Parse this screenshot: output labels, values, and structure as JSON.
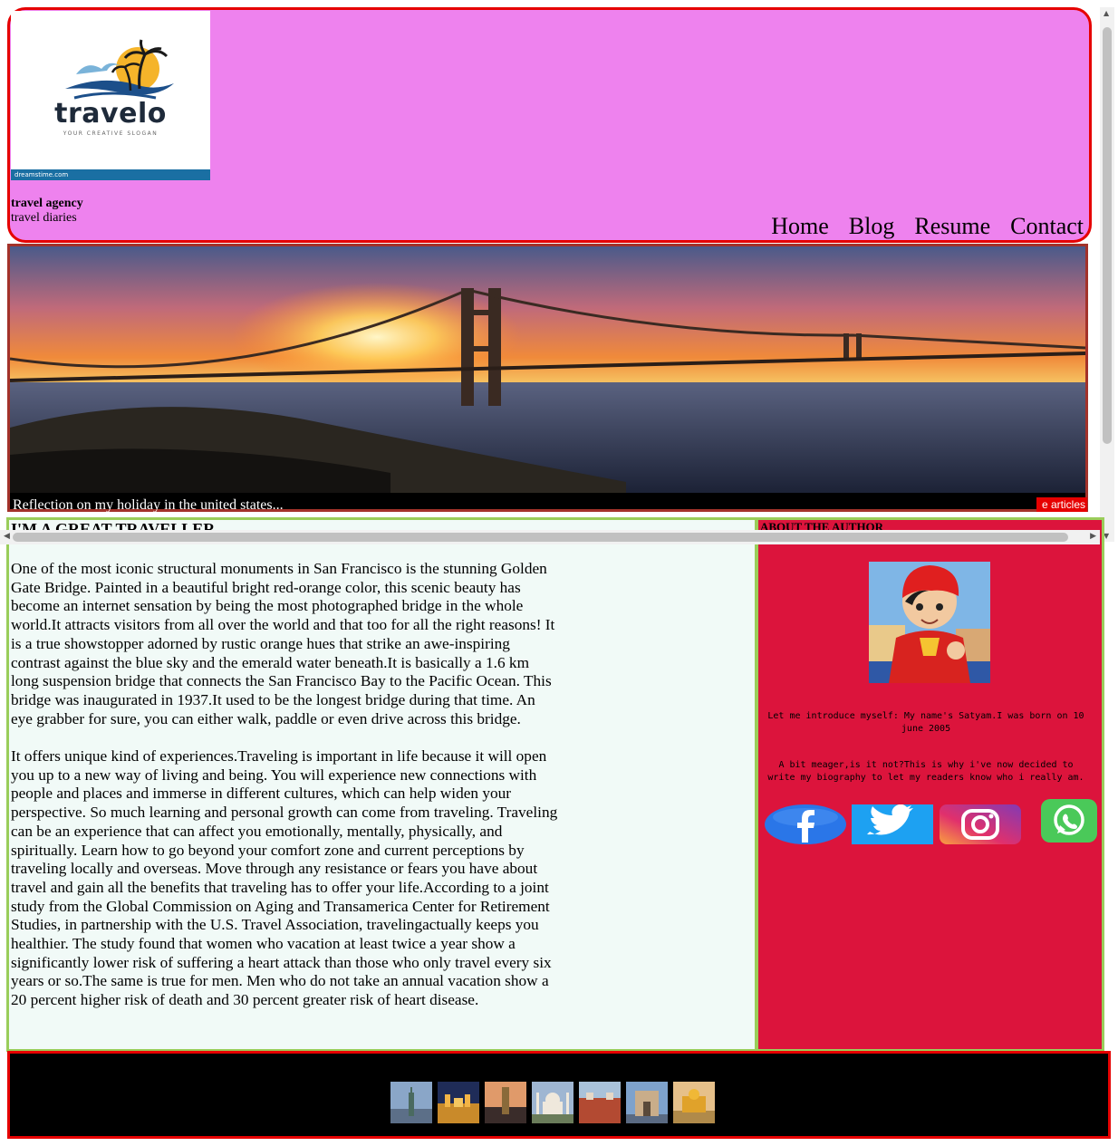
{
  "header": {
    "logo_text": "travelo",
    "logo_slogan": "YOUR CREATIVE SLOGAN",
    "logo_watermark": "dreamstime.com",
    "site_title": "travel agency",
    "site_subtitle": "travel diaries",
    "nav": [
      {
        "label": "Home"
      },
      {
        "label": "Blog"
      },
      {
        "label": "Resume"
      },
      {
        "label": "Contact"
      }
    ]
  },
  "hero": {
    "caption": "Reflection on my holiday in the united states...",
    "ticker": "e articles"
  },
  "article": {
    "heading": "I'M A GREAT TRAVELLER",
    "paragraphs": [
      "One of the most iconic structural monuments in San Francisco is the stunning Golden Gate Bridge. Painted in a beautiful bright red-orange color, this scenic beauty has become an internet sensation by being the most photographed bridge in the whole world.It attracts visitors from all over the world and that too for all the right reasons! It is a true showstopper adorned by rustic orange hues that strike an awe-inspiring contrast against the blue sky and the emerald water beneath.It is basically a 1.6 km long suspension bridge that connects the San Francisco Bay to the Pacific Ocean. This bridge was inaugurated in 1937.It used to be the longest bridge during that time. An eye grabber for sure, you can either walk, paddle or even drive across this bridge.",
      "It offers unique kind of experiences.Traveling is important in life because it will open you up to a new way of living and being. You will experience new connections with people and places and immerse in different cultures, which can help widen your perspective. So much learning and personal growth can come from traveling. Traveling can be an experience that can affect you emotionally, mentally, physically, and spiritually. Learn how to go beyond your comfort zone and current perceptions by traveling locally and overseas. Move through any resistance or fears you have about travel and gain all the benefits that traveling has to offer your life.According to a joint study from the Global Commission on Aging and Transamerica Center for Retirement Studies, in partnership with the U.S. Travel Association, travelingactually keeps you healthier. The study found that women who vacation at least twice a year show a significantly lower risk of suffering a heart attack than those who only travel every six years or so.The same is true for men. Men who do not take an annual vacation show a 20 percent higher risk of death and 30 percent greater risk of heart disease."
    ]
  },
  "sidebar": {
    "heading": "ABOUT THE AUTHOR",
    "bio_1": "Let me introduce myself: My name's Satyam.I was born on 10 june 2005",
    "bio_2": "A bit meager,is it not?This is why i've now decided to write my biography to let my readers know who i really am.",
    "social_icons": [
      "facebook-icon",
      "twitter-icon",
      "instagram-icon",
      "whatsapp-icon"
    ]
  },
  "footer": {
    "gallery_count_shown": 7
  },
  "colors": {
    "header_bg": "#ee82ee",
    "border_red": "#e60000",
    "sidebar_bg": "#dc143c",
    "article_bg": "#f1faf7",
    "green_border": "#9acd5a"
  }
}
